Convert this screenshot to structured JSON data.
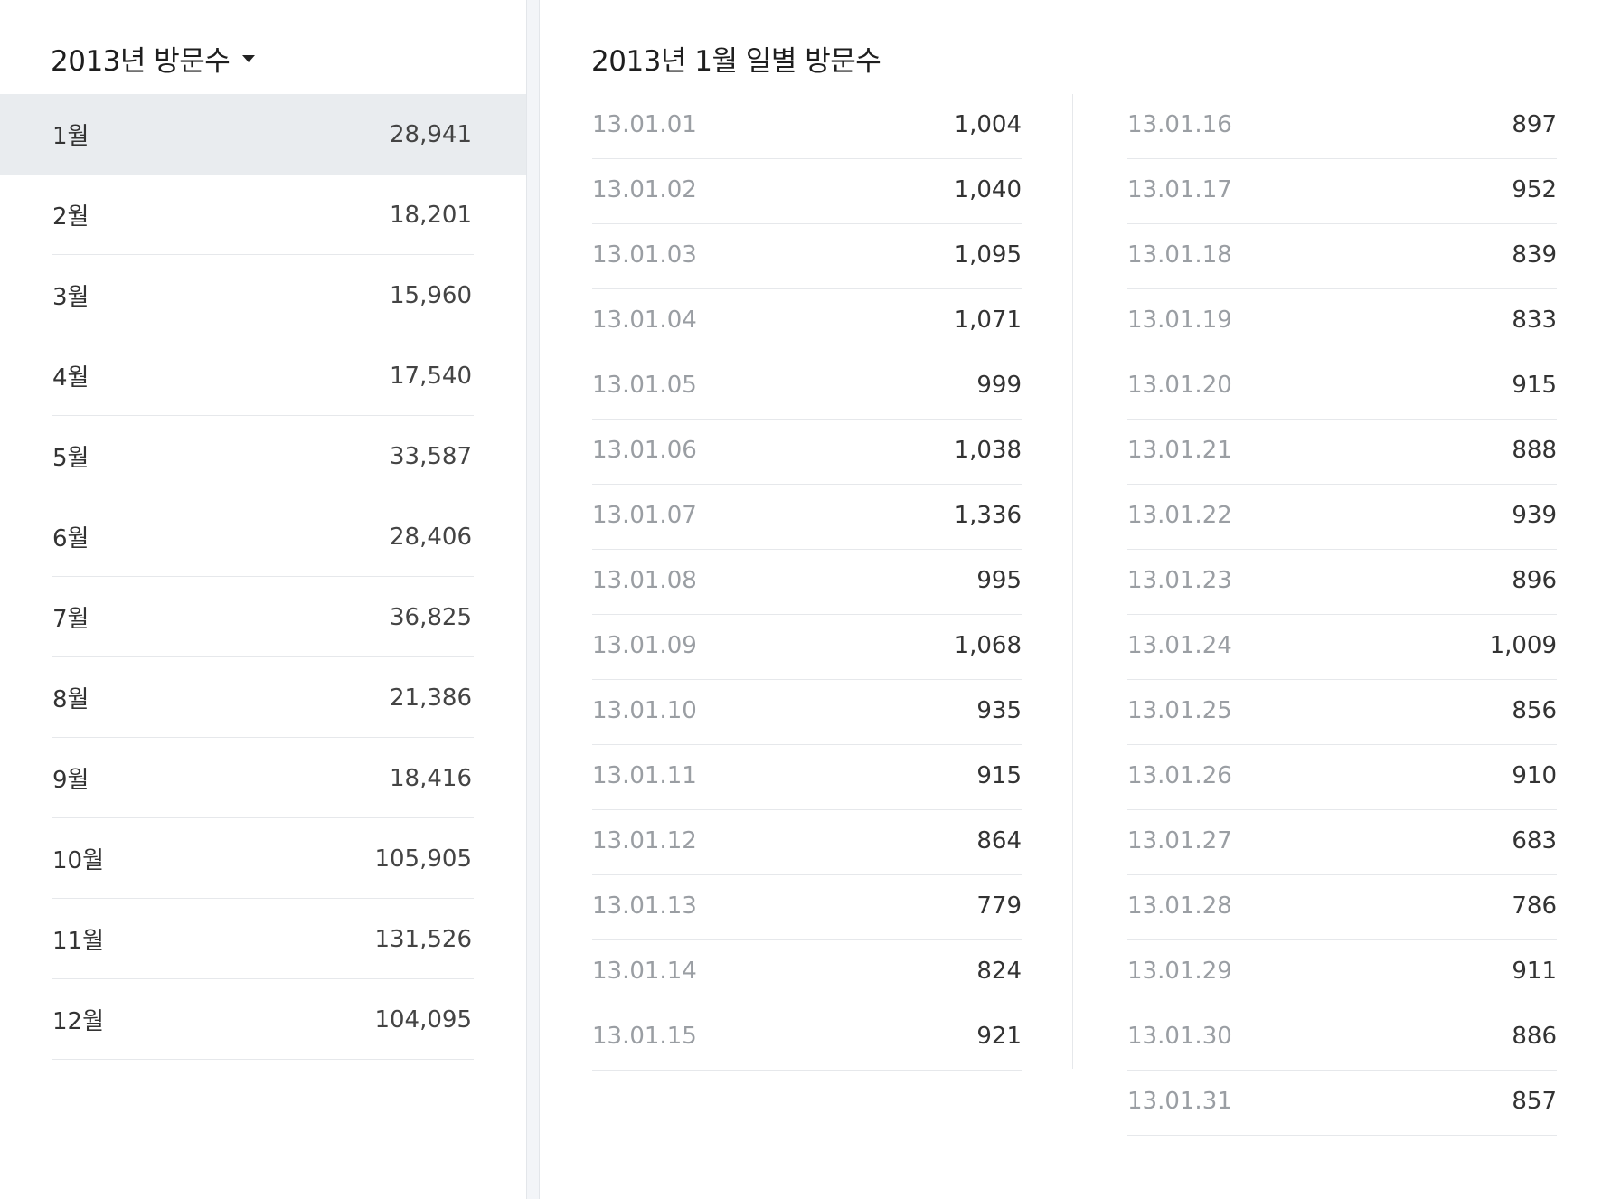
{
  "year_selector": {
    "label": "2013년 방문수",
    "icon": "caret-down-icon"
  },
  "months": [
    {
      "label": "1월",
      "value": "28,941",
      "selected": true
    },
    {
      "label": "2월",
      "value": "18,201"
    },
    {
      "label": "3월",
      "value": "15,960"
    },
    {
      "label": "4월",
      "value": "17,540"
    },
    {
      "label": "5월",
      "value": "33,587"
    },
    {
      "label": "6월",
      "value": "28,406"
    },
    {
      "label": "7월",
      "value": "36,825"
    },
    {
      "label": "8월",
      "value": "21,386"
    },
    {
      "label": "9월",
      "value": "18,416"
    },
    {
      "label": "10월",
      "value": "105,905"
    },
    {
      "label": "11월",
      "value": "131,526"
    },
    {
      "label": "12월",
      "value": "104,095"
    }
  ],
  "daily_title": "2013년 1월 일별 방문수",
  "daily": [
    {
      "date": "13.01.01",
      "value": "1,004"
    },
    {
      "date": "13.01.02",
      "value": "1,040"
    },
    {
      "date": "13.01.03",
      "value": "1,095"
    },
    {
      "date": "13.01.04",
      "value": "1,071"
    },
    {
      "date": "13.01.05",
      "value": "999"
    },
    {
      "date": "13.01.06",
      "value": "1,038"
    },
    {
      "date": "13.01.07",
      "value": "1,336"
    },
    {
      "date": "13.01.08",
      "value": "995"
    },
    {
      "date": "13.01.09",
      "value": "1,068"
    },
    {
      "date": "13.01.10",
      "value": "935"
    },
    {
      "date": "13.01.11",
      "value": "915"
    },
    {
      "date": "13.01.12",
      "value": "864"
    },
    {
      "date": "13.01.13",
      "value": "779"
    },
    {
      "date": "13.01.14",
      "value": "824"
    },
    {
      "date": "13.01.15",
      "value": "921"
    },
    {
      "date": "13.01.16",
      "value": "897"
    },
    {
      "date": "13.01.17",
      "value": "952"
    },
    {
      "date": "13.01.18",
      "value": "839"
    },
    {
      "date": "13.01.19",
      "value": "833"
    },
    {
      "date": "13.01.20",
      "value": "915"
    },
    {
      "date": "13.01.21",
      "value": "888"
    },
    {
      "date": "13.01.22",
      "value": "939"
    },
    {
      "date": "13.01.23",
      "value": "896"
    },
    {
      "date": "13.01.24",
      "value": "1,009"
    },
    {
      "date": "13.01.25",
      "value": "856"
    },
    {
      "date": "13.01.26",
      "value": "910"
    },
    {
      "date": "13.01.27",
      "value": "683"
    },
    {
      "date": "13.01.28",
      "value": "786"
    },
    {
      "date": "13.01.29",
      "value": "911"
    },
    {
      "date": "13.01.30",
      "value": "886"
    },
    {
      "date": "13.01.31",
      "value": "857"
    }
  ]
}
